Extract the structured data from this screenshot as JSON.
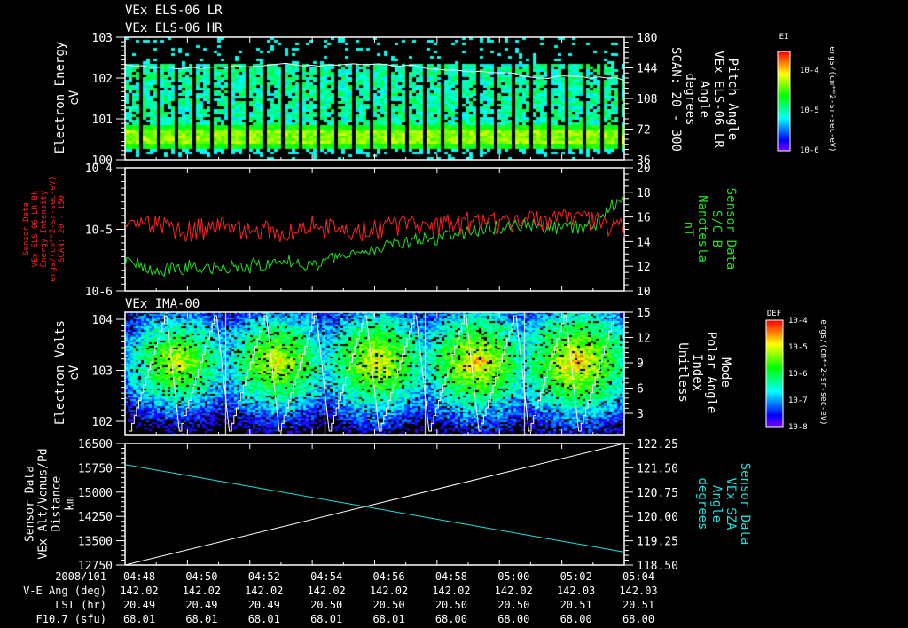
{
  "titles": {
    "line1": "VEx ELS-06 LR",
    "line2": "VEx ELS-06 HR",
    "panel3": "VEx IMA-00"
  },
  "colors": {
    "red": "#ff2020",
    "green": "#20e020",
    "cyan": "#20e0e0",
    "white": "#ffffff"
  },
  "chart_data": [
    {
      "type": "heatmap",
      "name": "ELS electron spectrogram",
      "ylabel": [
        "Electron Energy",
        "eV"
      ],
      "yticks": [
        "10^3",
        "10^2",
        "10^1",
        "10^0"
      ],
      "ylim": [
        1,
        1000
      ],
      "yscale": "log",
      "right_axis": {
        "labels": [
          "Pitch Angle",
          "VEx ELS-06 LR",
          "Angle",
          "degrees",
          "SCAN: 20 - 300"
        ],
        "ticks": [
          "180",
          "144",
          "108",
          "72",
          "36"
        ],
        "ylim": [
          0,
          180
        ]
      },
      "colorbar": {
        "title": "EI",
        "ticks": [
          "10^-4",
          "10^-5",
          "10^-6"
        ],
        "unit": "ergs/(cm**2-sr-sec-eV)"
      },
      "peak_band_eV": [
        3,
        5
      ],
      "pitch_angle_trace_deg": [
        140,
        135,
        136,
        138,
        140,
        138,
        141,
        137,
        132,
        128,
        120,
        122,
        118
      ]
    },
    {
      "type": "line",
      "name": "Energy intensity and B field",
      "left_axis": {
        "labels": [
          "Sensor Data",
          "VEx ELS-06 LR-Bk",
          "Energy Intensity",
          "ergs/(cm**2-sr-sec-eV)",
          "SCAN: 20 - 150"
        ],
        "ticks": [
          "10^-4",
          "10^-5",
          "10^-6"
        ],
        "ylim": [
          1e-06,
          0.0001
        ],
        "yscale": "log"
      },
      "right_axis": {
        "labels": [
          "Sensor Data",
          "S/C B",
          "Nanotesla",
          "nT"
        ],
        "ticks": [
          "20",
          "18",
          "16",
          "14",
          "12",
          "10"
        ],
        "ylim": [
          10,
          20
        ]
      },
      "series": [
        {
          "name": "Energy Intensity",
          "color": "red",
          "values": [
            1.1e-05,
            1.3e-05,
            1e-05,
            1.2e-05,
            1.1e-05,
            9e-06,
            1.2e-05,
            1e-05,
            1.1e-05,
            1.3e-05,
            1.2e-05,
            1.4e-05,
            1.3e-05,
            1.4e-05,
            1.5e-05,
            1.4e-05,
            1.2e-05
          ]
        },
        {
          "name": "S/C B",
          "color": "green",
          "values": [
            12.5,
            11.5,
            12.0,
            11.8,
            12.0,
            12.5,
            12.0,
            13.0,
            13.5,
            14.0,
            14.3,
            14.8,
            15.2,
            15.4,
            15.0,
            15.2,
            18.0
          ]
        }
      ]
    },
    {
      "type": "heatmap",
      "name": "IMA ion spectrogram",
      "ylabel": [
        "Electron Volts",
        "eV"
      ],
      "yticks": [
        "10^4",
        "10^3",
        "10^2"
      ],
      "yscale": "log",
      "right_axis": {
        "labels": [
          "Mode",
          "Polar Angle",
          "Index",
          "Unitless"
        ],
        "ticks": [
          "15",
          "12",
          "9",
          "6",
          "3"
        ],
        "ylim": [
          0,
          15
        ]
      },
      "colorbar": {
        "title": "DEF",
        "ticks": [
          "10^-4",
          "10^-5",
          "10^-6",
          "10^-7",
          "10^-8"
        ],
        "unit": "ergs/(cm**2-sr-sec-eV)"
      },
      "scan_segments": 5
    },
    {
      "type": "line",
      "name": "Altitude and SZA",
      "left_axis": {
        "labels": [
          "Sensor Data",
          "VEx Alt/Venus/Pd",
          "Distance",
          "km"
        ],
        "ticks": [
          "16500",
          "15750",
          "15000",
          "14250",
          "13500",
          "12750"
        ],
        "ylim": [
          12750,
          16500
        ]
      },
      "right_axis": {
        "labels": [
          "Sensor Data",
          "VEx SZA",
          "Angle",
          "degrees"
        ],
        "ticks": [
          "122.25",
          "121.50",
          "120.75",
          "120.00",
          "119.25",
          "118.50"
        ],
        "ylim": [
          118.5,
          122.25
        ]
      },
      "series": [
        {
          "name": "Altitude",
          "color": "white",
          "x": [
            "04:48",
            "05:04"
          ],
          "values": [
            12750,
            16500
          ]
        },
        {
          "name": "SZA",
          "color": "cyan",
          "x": [
            "04:48",
            "05:04"
          ],
          "values": [
            121.6,
            118.9
          ]
        }
      ]
    }
  ],
  "time_axis": {
    "date": "2008/101",
    "ticks": [
      "04:48",
      "04:50",
      "04:52",
      "04:54",
      "04:56",
      "04:58",
      "05:00",
      "05:02",
      "05:04"
    ],
    "rows": [
      {
        "label": "V-E Ang (deg)",
        "values": [
          "142.02",
          "142.02",
          "142.02",
          "142.02",
          "142.02",
          "142.02",
          "142.02",
          "142.03",
          "142.03"
        ]
      },
      {
        "label": "LST (hr)",
        "values": [
          "20.49",
          "20.49",
          "20.49",
          "20.50",
          "20.50",
          "20.50",
          "20.50",
          "20.51",
          "20.51"
        ]
      },
      {
        "label": "F10.7 (sfu)",
        "values": [
          "68.01",
          "68.01",
          "68.01",
          "68.01",
          "68.01",
          "68.00",
          "68.00",
          "68.00",
          "68.00"
        ]
      }
    ]
  }
}
